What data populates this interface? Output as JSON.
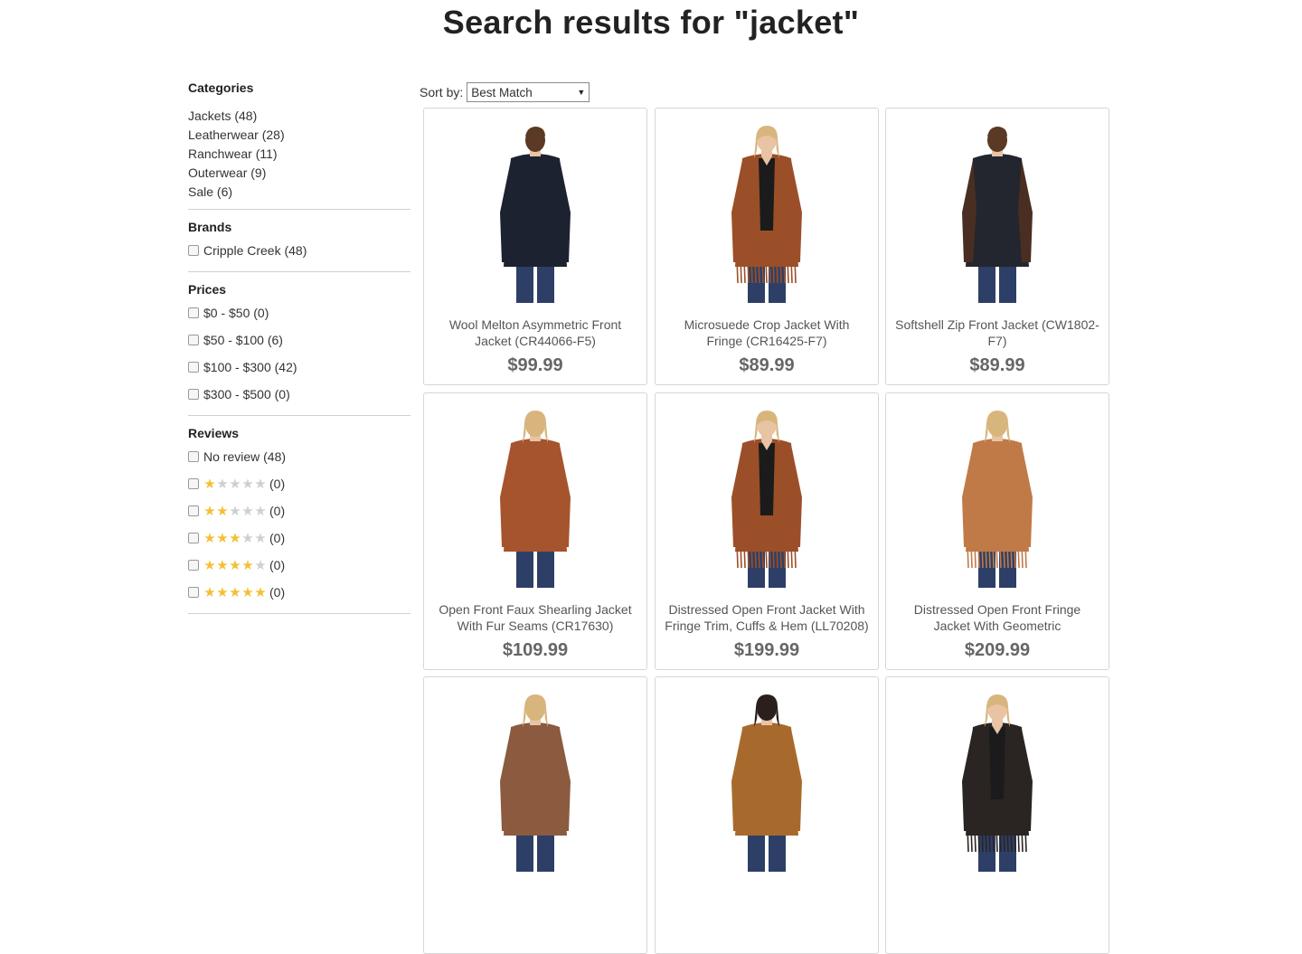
{
  "page": {
    "title": "Search results for \"jacket\""
  },
  "sidebar": {
    "categories": {
      "title": "Categories",
      "items": [
        "Jackets (48)",
        "Leatherwear (28)",
        "Ranchwear (11)",
        "Outerwear (9)",
        "Sale (6)"
      ]
    },
    "brands": {
      "title": "Brands",
      "items": [
        "Cripple Creek (48)"
      ]
    },
    "prices": {
      "title": "Prices",
      "items": [
        "$0 - $50 (0)",
        "$50 - $100 (6)",
        "$100 - $300 (42)",
        "$300 - $500 (0)"
      ]
    },
    "reviews": {
      "title": "Reviews",
      "no_review": "No review (48)",
      "star_rows": [
        {
          "stars": 1,
          "count": "(0)"
        },
        {
          "stars": 2,
          "count": "(0)"
        },
        {
          "stars": 3,
          "count": "(0)"
        },
        {
          "stars": 4,
          "count": "(0)"
        },
        {
          "stars": 5,
          "count": "(0)"
        }
      ]
    }
  },
  "sort": {
    "label": "Sort by:",
    "selected": "Best Match"
  },
  "colors": {
    "star_on": "#f3c034",
    "star_off": "#cfcfcf",
    "price": "#666666"
  },
  "products": [
    {
      "name": "Wool Melton Asymmetric Front Jacket (CR44066-F5)",
      "price": "$99.99",
      "icon": "man-black-jacket-photo"
    },
    {
      "name": "Microsuede Crop Jacket With Fringe (CR16425-F7)",
      "price": "$89.99",
      "icon": "woman-fringe-jacket-photo"
    },
    {
      "name": "Softshell Zip Front Jacket (CW1802-F7)",
      "price": "$89.99",
      "icon": "man-brown-black-jacket-photo"
    },
    {
      "name": "Open Front Faux Shearling Jacket With Fur Seams (CR17630)",
      "price": "$109.99",
      "icon": "woman-shearling-jacket-photo"
    },
    {
      "name": "Distressed Open Front Jacket With Fringe Trim, Cuffs & Hem (LL70208)",
      "price": "$199.99",
      "icon": "woman-fringe-jacket-photo"
    },
    {
      "name": "Distressed Open Front Fringe Jacket With Geometric Embroidery...",
      "price": "$209.99",
      "icon": "woman-fringe-jacket-back-photo"
    },
    {
      "name": "",
      "price": "",
      "icon": "woman-jacket-back-photo"
    },
    {
      "name": "",
      "price": "",
      "icon": "woman-suede-jacket-back-photo"
    },
    {
      "name": "",
      "price": "",
      "icon": "woman-black-fringe-jacket-photo"
    }
  ]
}
